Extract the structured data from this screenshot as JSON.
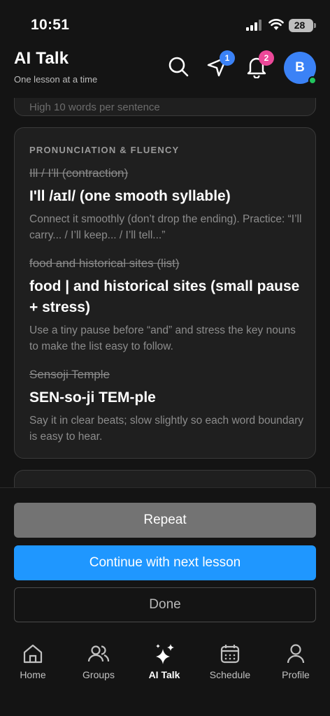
{
  "status_bar": {
    "time": "10:51",
    "battery": "28"
  },
  "header": {
    "title": "AI Talk",
    "subtitle": "One lesson at a time",
    "icons": [
      "search-icon",
      "send-icon",
      "bell-icon"
    ],
    "send_badge": "1",
    "bell_badge": "2",
    "avatar_initial": "B",
    "colors": {
      "send_badge": "#3b82f6",
      "bell_badge": "#ec4899",
      "avatar": "#3b82f6",
      "online": "#22c55e"
    }
  },
  "previous_card": {
    "text": "High 10 words per sentence"
  },
  "section": {
    "title": "PRONUNCIATION & FLUENCY",
    "items": [
      {
        "original": "Ill / I'll (contraction)",
        "corrected": "I'll /aɪl/ (one smooth syllable)",
        "note": "Connect it smoothly (don’t drop the ending). Practice: “I’ll carry... / I’ll keep... / I’ll tell...”"
      },
      {
        "original": "food and historical sites (list)",
        "corrected": "food | and historical sites (small pause + stress)",
        "note": "Use a tiny pause before “and” and stress the key nouns to make the list easy to follow."
      },
      {
        "original": "Sensoji Temple",
        "corrected": "SEN-so-ji TEM-ple",
        "note": "Say it in clear beats; slow slightly so each word boundary is easy to hear."
      }
    ]
  },
  "actions": {
    "repeat": "Repeat",
    "continue": "Continue with next lesson",
    "done": "Done",
    "colors": {
      "repeat": "#737373",
      "continue": "#1f97ff"
    }
  },
  "tabs": [
    {
      "label": "Home",
      "icon": "home-icon"
    },
    {
      "label": "Groups",
      "icon": "groups-icon"
    },
    {
      "label": "AI Talk",
      "icon": "sparkles-icon",
      "active": true
    },
    {
      "label": "Schedule",
      "icon": "calendar-icon"
    },
    {
      "label": "Profile",
      "icon": "profile-icon"
    }
  ]
}
